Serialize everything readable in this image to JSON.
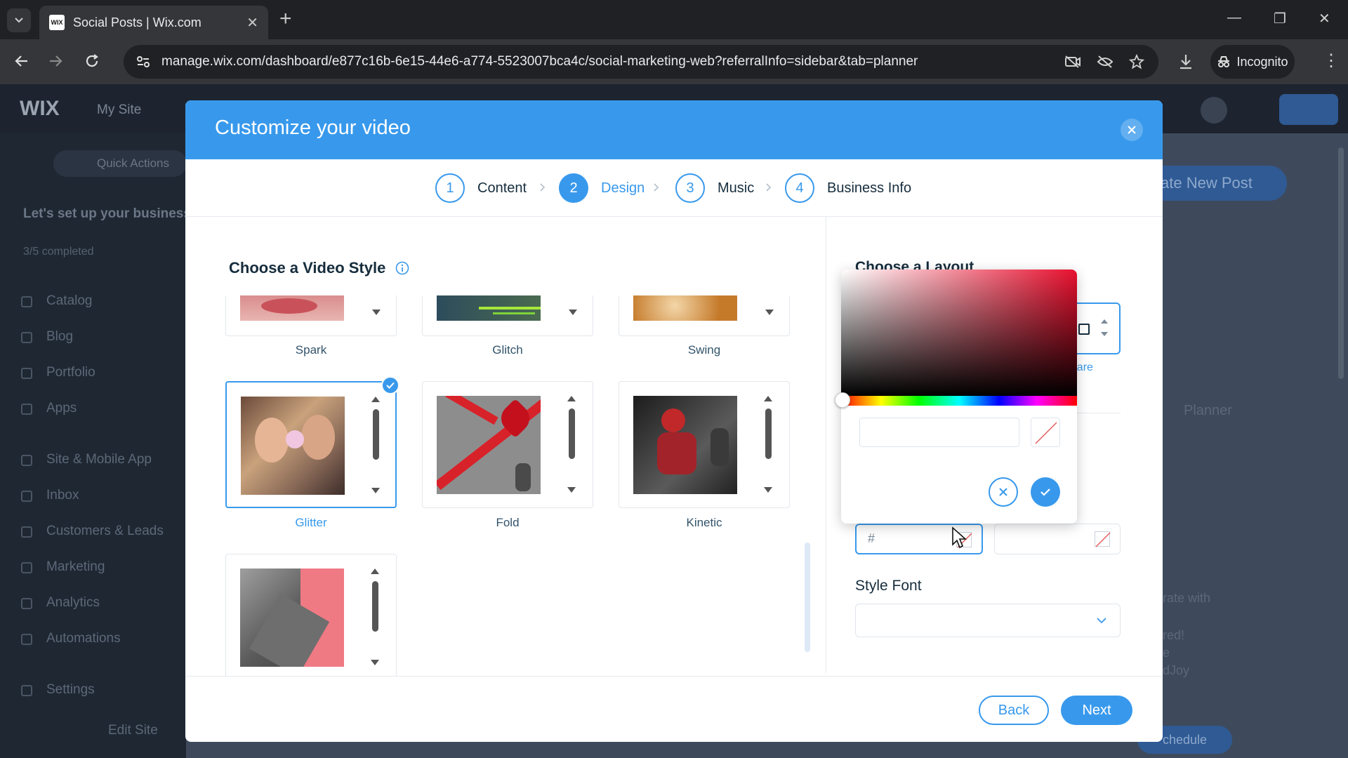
{
  "browser": {
    "tab_title": "Social Posts | Wix.com",
    "favicon_text": "WIX",
    "url": "manage.wix.com/dashboard/e877c16b-6e15-44e6-a774-5523007bca4c/social-marketing-web?referralInfo=sidebar&tab=planner",
    "incognito_label": "Incognito"
  },
  "dashboard": {
    "logo": "WIX",
    "site_name": "My Site",
    "quick_actions": "Quick Actions",
    "setup_title": "Let's set up your business",
    "setup_progress": "3/5 completed",
    "sidebar_items": [
      "Catalog",
      "Blog",
      "Portfolio",
      "Apps",
      "Site & Mobile App",
      "Inbox",
      "Customers & Leads",
      "Marketing",
      "Analytics",
      "Automations",
      "Settings"
    ],
    "edit_site": "Edit Site",
    "create_post": "ate New Post",
    "planner_text": "Planner",
    "bg_snippets": [
      "rate with",
      "red!",
      "e",
      "dJoy",
      "chedule"
    ]
  },
  "modal": {
    "title": "Customize your video",
    "steps": [
      {
        "number": "1",
        "label": "Content"
      },
      {
        "number": "2",
        "label": "Design"
      },
      {
        "number": "3",
        "label": "Music"
      },
      {
        "number": "4",
        "label": "Business Info"
      }
    ],
    "active_step": 2,
    "video_style_title": "Choose a Video Style",
    "styles": [
      {
        "label": "Spark"
      },
      {
        "label": "Glitch"
      },
      {
        "label": "Swing"
      },
      {
        "label": "Glitter"
      },
      {
        "label": "Fold"
      },
      {
        "label": "Kinetic"
      },
      {
        "label": ""
      }
    ],
    "selected_style": "Glitter",
    "layout_title": "Choose a Layout",
    "layout_link": "quare",
    "hex_placeholder": "#",
    "style_font_label": "Style Font",
    "back_label": "Back",
    "next_label": "Next"
  },
  "colors": {
    "accent": "#3899ec",
    "picker_hue": "#e8102e"
  }
}
